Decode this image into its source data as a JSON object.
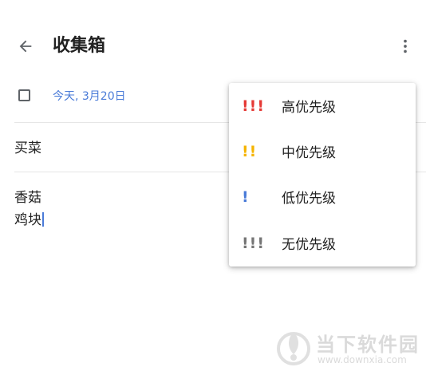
{
  "header": {
    "title": "收集箱",
    "back_icon": "arrow-left-icon",
    "more_icon": "more-vertical-icon"
  },
  "task": {
    "due_date": "今天, 3月20日",
    "title": "买菜",
    "notes": [
      "香菇",
      "鸡块"
    ]
  },
  "priority_menu": {
    "items": [
      {
        "marks": "!!!",
        "label": "高优先级",
        "color": "#e53935"
      },
      {
        "marks": "!!",
        "label": "中优先级",
        "color": "#f5b400"
      },
      {
        "marks": "!",
        "label": "低优先级",
        "color": "#4a7bd8"
      },
      {
        "marks": "!!!",
        "label": "无优先级",
        "color": "#757575"
      }
    ]
  },
  "colors": {
    "accent": "#4a7bd8",
    "text": "#212121"
  },
  "watermark": {
    "title": "当下软件园",
    "url": "www.downxia.com"
  }
}
